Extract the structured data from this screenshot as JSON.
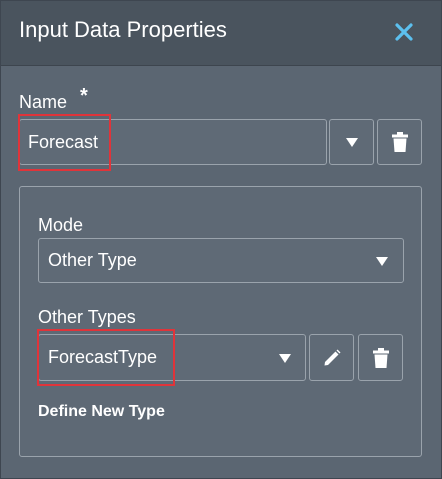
{
  "dialog": {
    "title": "Input Data Properties",
    "close_icon": "close-icon",
    "accent_color": "#5cc0ef"
  },
  "name_section": {
    "label": "Name",
    "required_marker": "*",
    "value": "Forecast",
    "dropdown_icon": "chevron-down-icon",
    "delete_icon": "trash-icon"
  },
  "mode_section": {
    "label": "Mode",
    "selected": "Other Type",
    "dropdown_icon": "chevron-down-icon"
  },
  "other_types_section": {
    "label": "Other Types",
    "selected": "ForecastType",
    "dropdown_icon": "chevron-down-icon",
    "edit_icon": "pencil-icon",
    "delete_icon": "trash-icon",
    "define_new_type_link": "Define New Type"
  },
  "highlight_color": "#e0343a"
}
